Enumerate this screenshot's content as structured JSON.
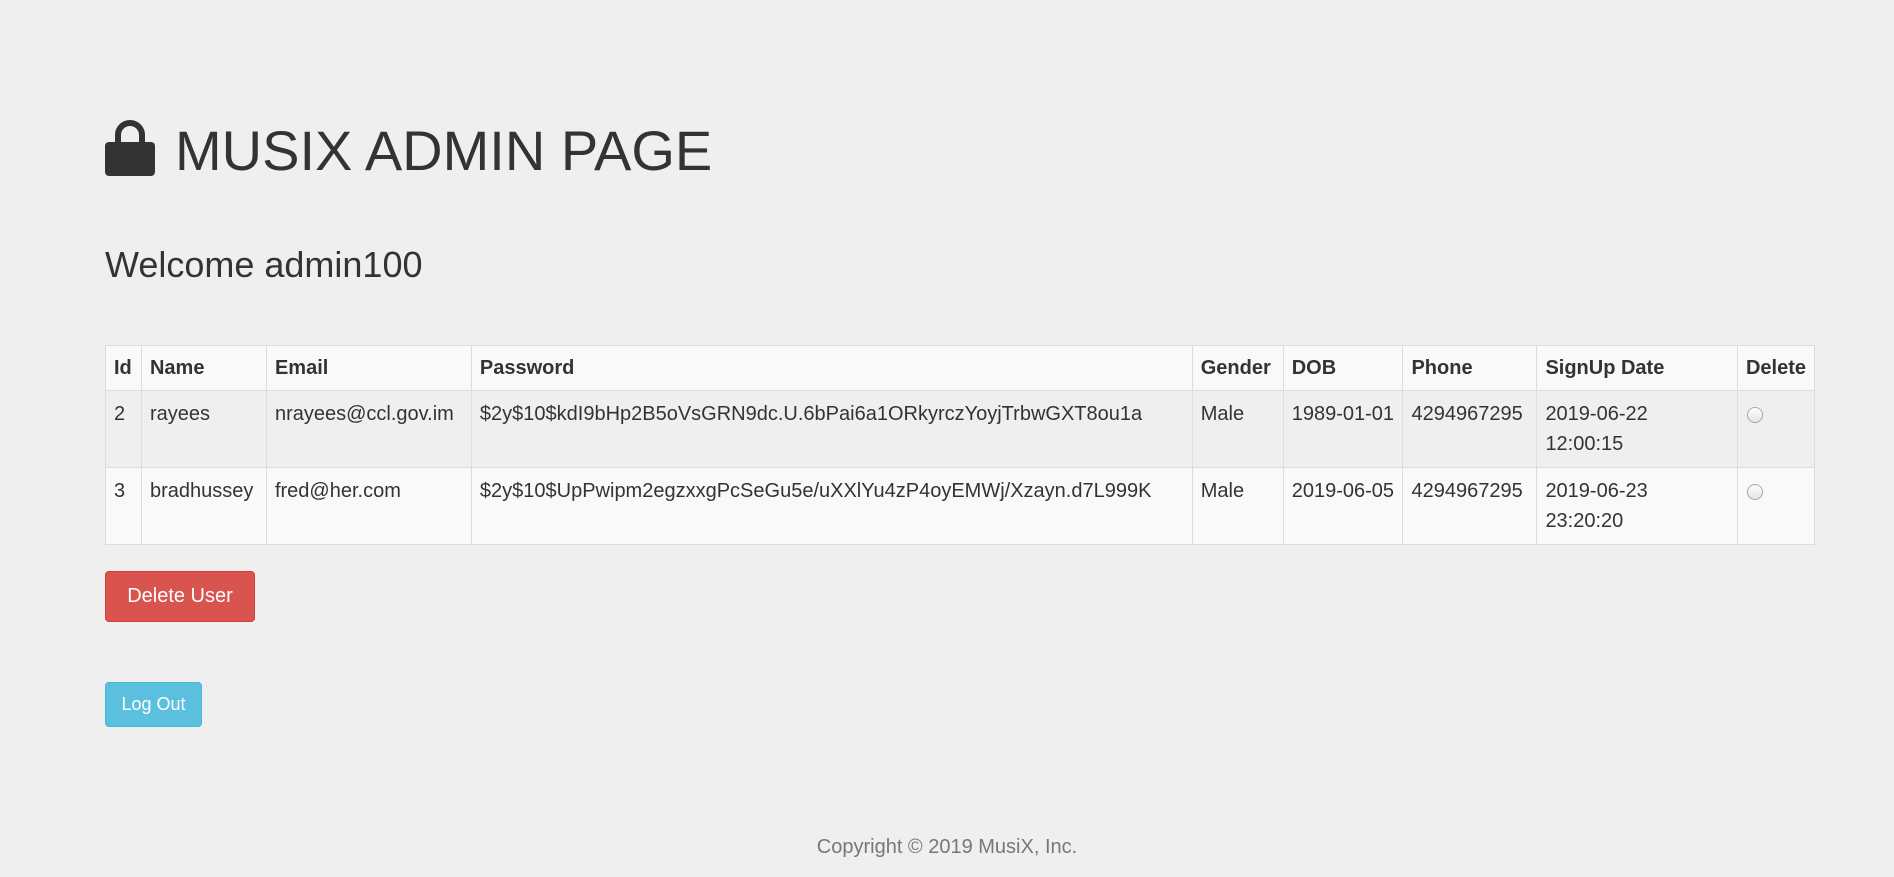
{
  "header": {
    "icon": "lock-icon",
    "title": "MUSIX ADMIN PAGE",
    "welcome": "Welcome admin100"
  },
  "table": {
    "columns": [
      "Id",
      "Name",
      "Email",
      "Password",
      "Gender",
      "DOB",
      "Phone",
      "SignUp Date",
      "Delete"
    ],
    "rows": [
      {
        "id": "2",
        "name": "rayees",
        "email": "nrayees@ccl.gov.im",
        "password": "$2y$10$kdI9bHp2B5oVsGRN9dc.U.6bPai6a1ORkyrczYoyjTrbwGXT8ou1a",
        "gender": "Male",
        "dob": "1989-01-01",
        "phone": "4294967295",
        "signup_date": "2019-06-22 12:00:15",
        "delete_selected": false
      },
      {
        "id": "3",
        "name": "bradhussey",
        "email": "fred@her.com",
        "password": "$2y$10$UpPwipm2egzxxgPcSeGu5e/uXXlYu4zP4oyEMWj/Xzayn.d7L999K",
        "gender": "Male",
        "dob": "2019-06-05",
        "phone": "4294967295",
        "signup_date": "2019-06-23 23:20:20",
        "delete_selected": false
      }
    ]
  },
  "actions": {
    "delete_user_label": "Delete User",
    "logout_label": "Log Out"
  },
  "footer": {
    "copyright": "Copyright © 2019 MusiX, Inc."
  },
  "colors": {
    "background": "#efefef",
    "danger": "#d9534f",
    "info": "#5bc0de",
    "text": "#333333"
  }
}
